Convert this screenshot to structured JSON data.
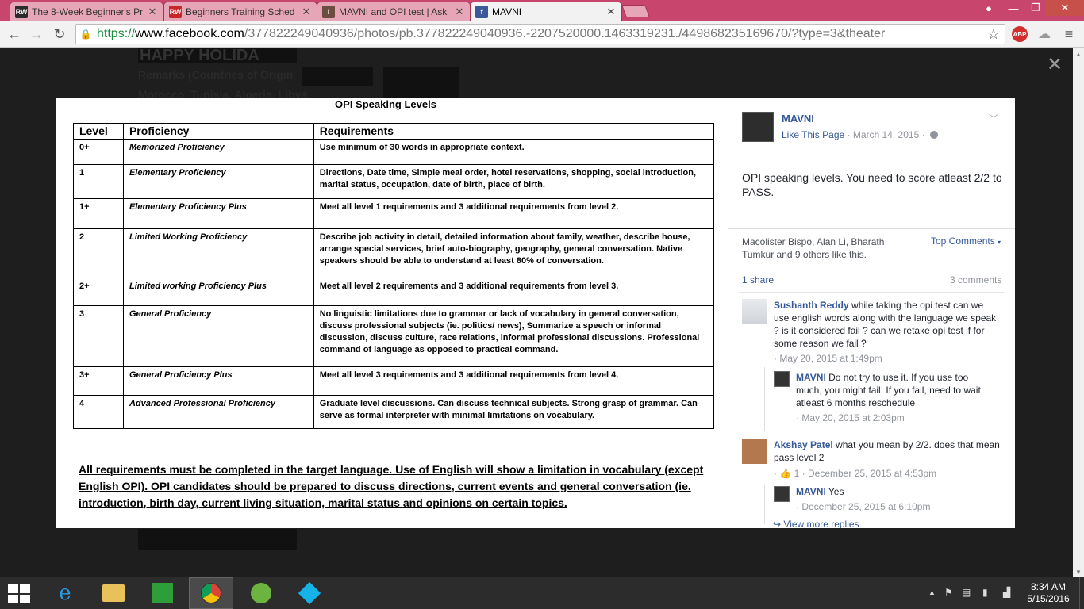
{
  "browser": {
    "tabs": [
      {
        "title": "The 8-Week Beginner's Pr",
        "favicon": "RW",
        "favicon_color": "#2b2b2b",
        "active": false
      },
      {
        "title": "Beginners Training Sched",
        "favicon": "RW",
        "favicon_color": "#c62828",
        "active": false
      },
      {
        "title": "MAVNI and OPI test | Ask",
        "favicon": "i",
        "favicon_color": "#6d4c41",
        "active": false
      },
      {
        "title": "MAVNI",
        "favicon": "f",
        "favicon_color": "#3b5998",
        "active": true
      }
    ],
    "url_scheme": "https://",
    "url_host": "www.facebook.com",
    "url_path": "/377822249040936/photos/pb.377822249040936.-2207520000.1463319231./449868235169670/?type=3&theater",
    "abp_label": "ABP",
    "theme_color": "#c8466e"
  },
  "photo_doc": {
    "title": "OPI Speaking Levels",
    "headers": [
      "Level",
      "Proficiency",
      "Requirements"
    ],
    "rows": [
      {
        "level": "0+",
        "proficiency": "Memorized Proficiency",
        "requirements": "Use minimum of 30 words in appropriate context."
      },
      {
        "level": "1",
        "proficiency": "Elementary Proficiency",
        "requirements": "Directions, Date time, Simple meal order, hotel reservations, shopping, social introduction, marital status, occupation, date of birth, place of birth."
      },
      {
        "level": "1+",
        "proficiency": "Elementary Proficiency Plus",
        "requirements": "Meet all level 1 requirements and 3 additional requirements from level 2."
      },
      {
        "level": "2",
        "proficiency": "Limited Working Proficiency",
        "requirements": "Describe job activity in detail, detailed information about family, weather, describe house, arrange special services, brief auto-biography, geography, general conversation. Native speakers should be able to understand at least 80% of conversation."
      },
      {
        "level": "2+",
        "proficiency": "Limited working Proficiency Plus",
        "requirements": "Meet all level 2 requirements and 3 additional requirements from level 3."
      },
      {
        "level": "3",
        "proficiency": "General Proficiency",
        "requirements": "No linguistic limitations due to grammar or lack of vocabulary in general conversation, discuss professional subjects (ie. politics/ news), Summarize a speech or informal discussion, discuss culture, race relations, informal professional discussions. Professional command of language as opposed to practical command."
      },
      {
        "level": "3+",
        "proficiency": "General Proficiency Plus",
        "requirements": "Meet all level 3 requirements and 3 additional requirements from level 4."
      },
      {
        "level": "4",
        "proficiency": "Advanced Professional Proficiency",
        "requirements": "Graduate level discussions. Can discuss technical subjects. Strong grasp of grammar. Can serve as formal interpreter with minimal limitations on vocabulary."
      }
    ],
    "note": "All requirements must be completed in the target language. Use of English will show a limitation in vocabulary (except English OPI). OPI candidates should be prepared to discuss directions, current events and general conversation (ie. introduction, birth day, current living situation, marital status and opinions on certain topics."
  },
  "background_fragments": {
    "line1": "HAPPY HOLIDA",
    "line2": "Remarks (Countries of Origin",
    "line3": "Morocco, Tunisia, Algeria, Libya"
  },
  "post": {
    "page_name": "MAVNI",
    "like_label": "Like This Page",
    "date": "March 14, 2015",
    "text": "OPI speaking levels. You need to score atleast 2/2 to PASS.",
    "likes_summary": "Macolister Bispo, Alan Li, Bharath Tumkur and 9 others like this.",
    "top_comments_label": "Top Comments",
    "shares": "1 share",
    "comments_count": "3 comments",
    "view_more": "View more replies"
  },
  "comments": [
    {
      "author": "Sushanth Reddy",
      "text": "while taking the opi test can we use english words along with the language we speak ? is it considered fail ? can we retake opi test if for some reason we fail ?",
      "time": "May 20, 2015 at 1:49pm"
    },
    {
      "author": "MAVNI",
      "text": "Do not try to use it. If you use too much, you might fail. If you fail, need to wait atleast 6 months reschedule",
      "time": "May 20, 2015 at 2:03pm"
    },
    {
      "author": "Akshay Patel",
      "text": "what you mean by 2/2. does that mean pass level 2",
      "likes": "1",
      "time": "December 25, 2015 at 4:53pm"
    },
    {
      "author": "MAVNI",
      "text": "Yes",
      "time": "December 25, 2015 at 6:10pm"
    }
  ],
  "taskbar": {
    "time": "8:34 AM",
    "date": "5/15/2016"
  }
}
